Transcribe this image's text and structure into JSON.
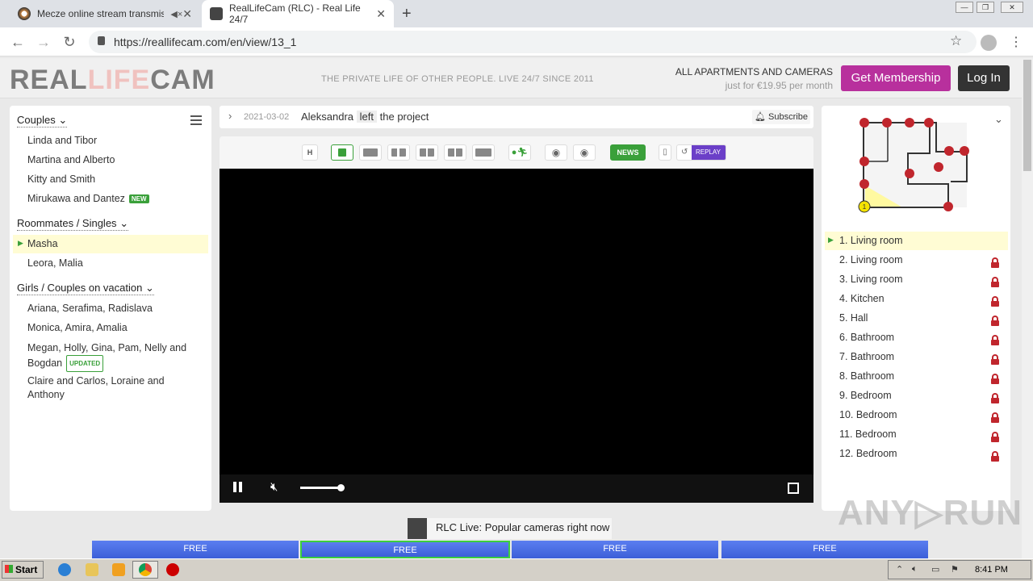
{
  "browser": {
    "tabs": [
      {
        "title": "Mecze online stream transmisje",
        "muted_icon": "speaker-muted-icon"
      },
      {
        "title": "RealLifeCam (RLC) - Real Life 24/7"
      }
    ],
    "url": "https://reallifecam.com/en/view/13_1"
  },
  "header": {
    "logo": {
      "part1": "REAL",
      "part2": "LIFE",
      "part3": "CAM"
    },
    "tagline": "THE PRIVATE LIFE OF OTHER PEOPLE. LIVE 24/7 SINCE 2011",
    "promo_title": "ALL APARTMENTS AND CAMERAS",
    "promo_price": "just for €19.95 per month",
    "membership_button": "Get Membership",
    "login_button": "Log In"
  },
  "sidebar": {
    "groups": [
      {
        "title": "Couples",
        "items": [
          {
            "label": "Linda and Tibor"
          },
          {
            "label": "Martina and Alberto"
          },
          {
            "label": "Kitty and Smith"
          },
          {
            "label": "Mirukawa and Dantez",
            "badge": "NEW"
          }
        ]
      },
      {
        "title": "Roommates / Singles",
        "items": [
          {
            "label": "Masha",
            "active": true
          },
          {
            "label": "Leora, Malia"
          }
        ]
      },
      {
        "title": "Girls / Couples on vacation",
        "items": [
          {
            "label": "Ariana, Serafima, Radislava"
          },
          {
            "label": "Monica, Amira, Amalia"
          },
          {
            "label": "Megan, Holly, Gina, Pam, Nelly and",
            "label2": "Bogdan",
            "badge": "UPDATED"
          },
          {
            "label": "Claire and Carlos, Loraine and",
            "label2": "Anthony"
          }
        ]
      }
    ]
  },
  "news": {
    "date": "2021-03-02",
    "name": "Aleksandra",
    "action": "left",
    "rest": "the project",
    "subscribe": "Subscribe"
  },
  "toolbar": {
    "h_label": "H",
    "news_label": "NEWS",
    "replay_label": "REPLAY"
  },
  "player": {
    "state": "playing",
    "muted": true,
    "volume": 0.85
  },
  "cameras": [
    {
      "label": "1. Living room",
      "active": true,
      "locked": false
    },
    {
      "label": "2. Living room",
      "locked": true
    },
    {
      "label": "3. Living room",
      "locked": true
    },
    {
      "label": "4. Kitchen",
      "locked": true
    },
    {
      "label": "5. Hall",
      "locked": true
    },
    {
      "label": "6. Bathroom",
      "locked": true
    },
    {
      "label": "7. Bathroom",
      "locked": true
    },
    {
      "label": "8. Bathroom",
      "locked": true
    },
    {
      "label": "9. Bedroom",
      "locked": true
    },
    {
      "label": "10. Bedroom",
      "locked": true
    },
    {
      "label": "11. Bedroom",
      "locked": true
    },
    {
      "label": "12. Bedroom",
      "locked": true
    }
  ],
  "map": {
    "active_marker": "1"
  },
  "live": {
    "title": "RLC Live: Popular cameras right now",
    "thumbs": [
      "FREE",
      "FREE",
      "FREE",
      "FREE"
    ]
  },
  "watermark": "ANY▷RUN",
  "taskbar": {
    "start": "Start",
    "clock": "8:41 PM"
  },
  "colors": {
    "membership": "#b8309d",
    "active_row": "#fffcd4",
    "lock": "#c0262d",
    "new_badge": "#3aa03a"
  }
}
